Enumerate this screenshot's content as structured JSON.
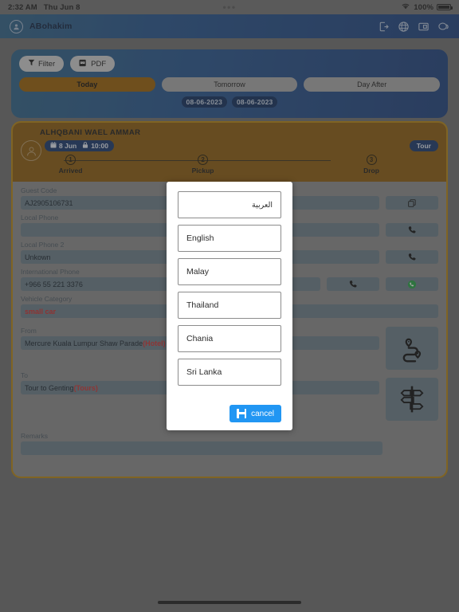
{
  "status_bar": {
    "time": "2:32 AM",
    "date": "Thu Jun 8",
    "center_dots": "•••",
    "battery_text": "100%",
    "wifi_icon": "wifi-icon",
    "battery_icon": "battery-full-icon"
  },
  "app_bar": {
    "user": "ABohakim",
    "avatar_icon": "user-avatar-icon",
    "icons": [
      {
        "name": "logout-icon"
      },
      {
        "name": "globe-icon"
      },
      {
        "name": "id-card-icon"
      },
      {
        "name": "chat-bubble-icon"
      }
    ]
  },
  "filter_panel": {
    "filter_label": "Filter",
    "filter_icon": "funnel-icon",
    "pdf_label": "PDF",
    "pdf_icon": "pdf-file-icon",
    "day_tabs": [
      {
        "label": "Today",
        "active": true
      },
      {
        "label": "Tomorrow",
        "active": false
      },
      {
        "label": "Day After",
        "active": false
      }
    ],
    "date_badges": [
      "08-06-2023",
      "08-06-2023"
    ]
  },
  "booking_card": {
    "guest_name": "ALHQBANI WAEL AMMAR",
    "date_chip": "8 Jun",
    "time_chip": "10:00",
    "calendar_icon": "calendar-icon",
    "clock_icon": "lock-clock-icon",
    "tour_badge": "Tour",
    "avatar_icon": "person-circle-icon",
    "steps": [
      {
        "num": "1",
        "label": "Arrived"
      },
      {
        "num": "2",
        "label": "Pickup"
      },
      {
        "num": "3",
        "label": "Drop"
      }
    ],
    "fields": {
      "guest_code": {
        "label": "Guest Code",
        "value": "AJ2905106731",
        "action_icon": "copy-icon"
      },
      "local_phone": {
        "label": "Local Phone",
        "value": "",
        "action_icon": "phone-icon"
      },
      "local_phone_2": {
        "label": "Local Phone 2",
        "value": "Unkown",
        "action_icon": "phone-icon"
      },
      "international_phone": {
        "label": "International Phone",
        "value": "+966 55 221 3376",
        "action_icon": "phone-icon",
        "action_icon_2": "whatsapp-icon"
      },
      "vehicle_category": {
        "label": "Vehicle Category",
        "value": "small car"
      },
      "from": {
        "label": "From",
        "value": "Mercure Kuala Lumpur Shaw Parade ",
        "tag": "(Hotel)",
        "action_icon": "route-map-icon"
      },
      "to": {
        "label": "To",
        "value": "Tour to Genting ",
        "tag": "(Tours)",
        "action_icon": "signpost-icon"
      },
      "remarks": {
        "label": "Remarks",
        "value": ""
      }
    }
  },
  "language_modal": {
    "options": [
      {
        "label": "العربية",
        "rtl": true
      },
      {
        "label": "English",
        "rtl": false
      },
      {
        "label": "Malay",
        "rtl": false
      },
      {
        "label": "Thailand",
        "rtl": false
      },
      {
        "label": "Chania",
        "rtl": false
      },
      {
        "label": "Sri Lanka",
        "rtl": false
      }
    ],
    "cancel_label": "cancel",
    "cancel_icon": "save-disk-icon"
  },
  "colors": {
    "accent_blue": "#1d3f7c",
    "brand_orange": "#8a5a0b",
    "border_gold": "#b8860f",
    "field_bg": "#6b7d87",
    "danger_red": "#d22b2b",
    "primary_button": "#2196f3",
    "whatsapp_green": "#25a244"
  }
}
